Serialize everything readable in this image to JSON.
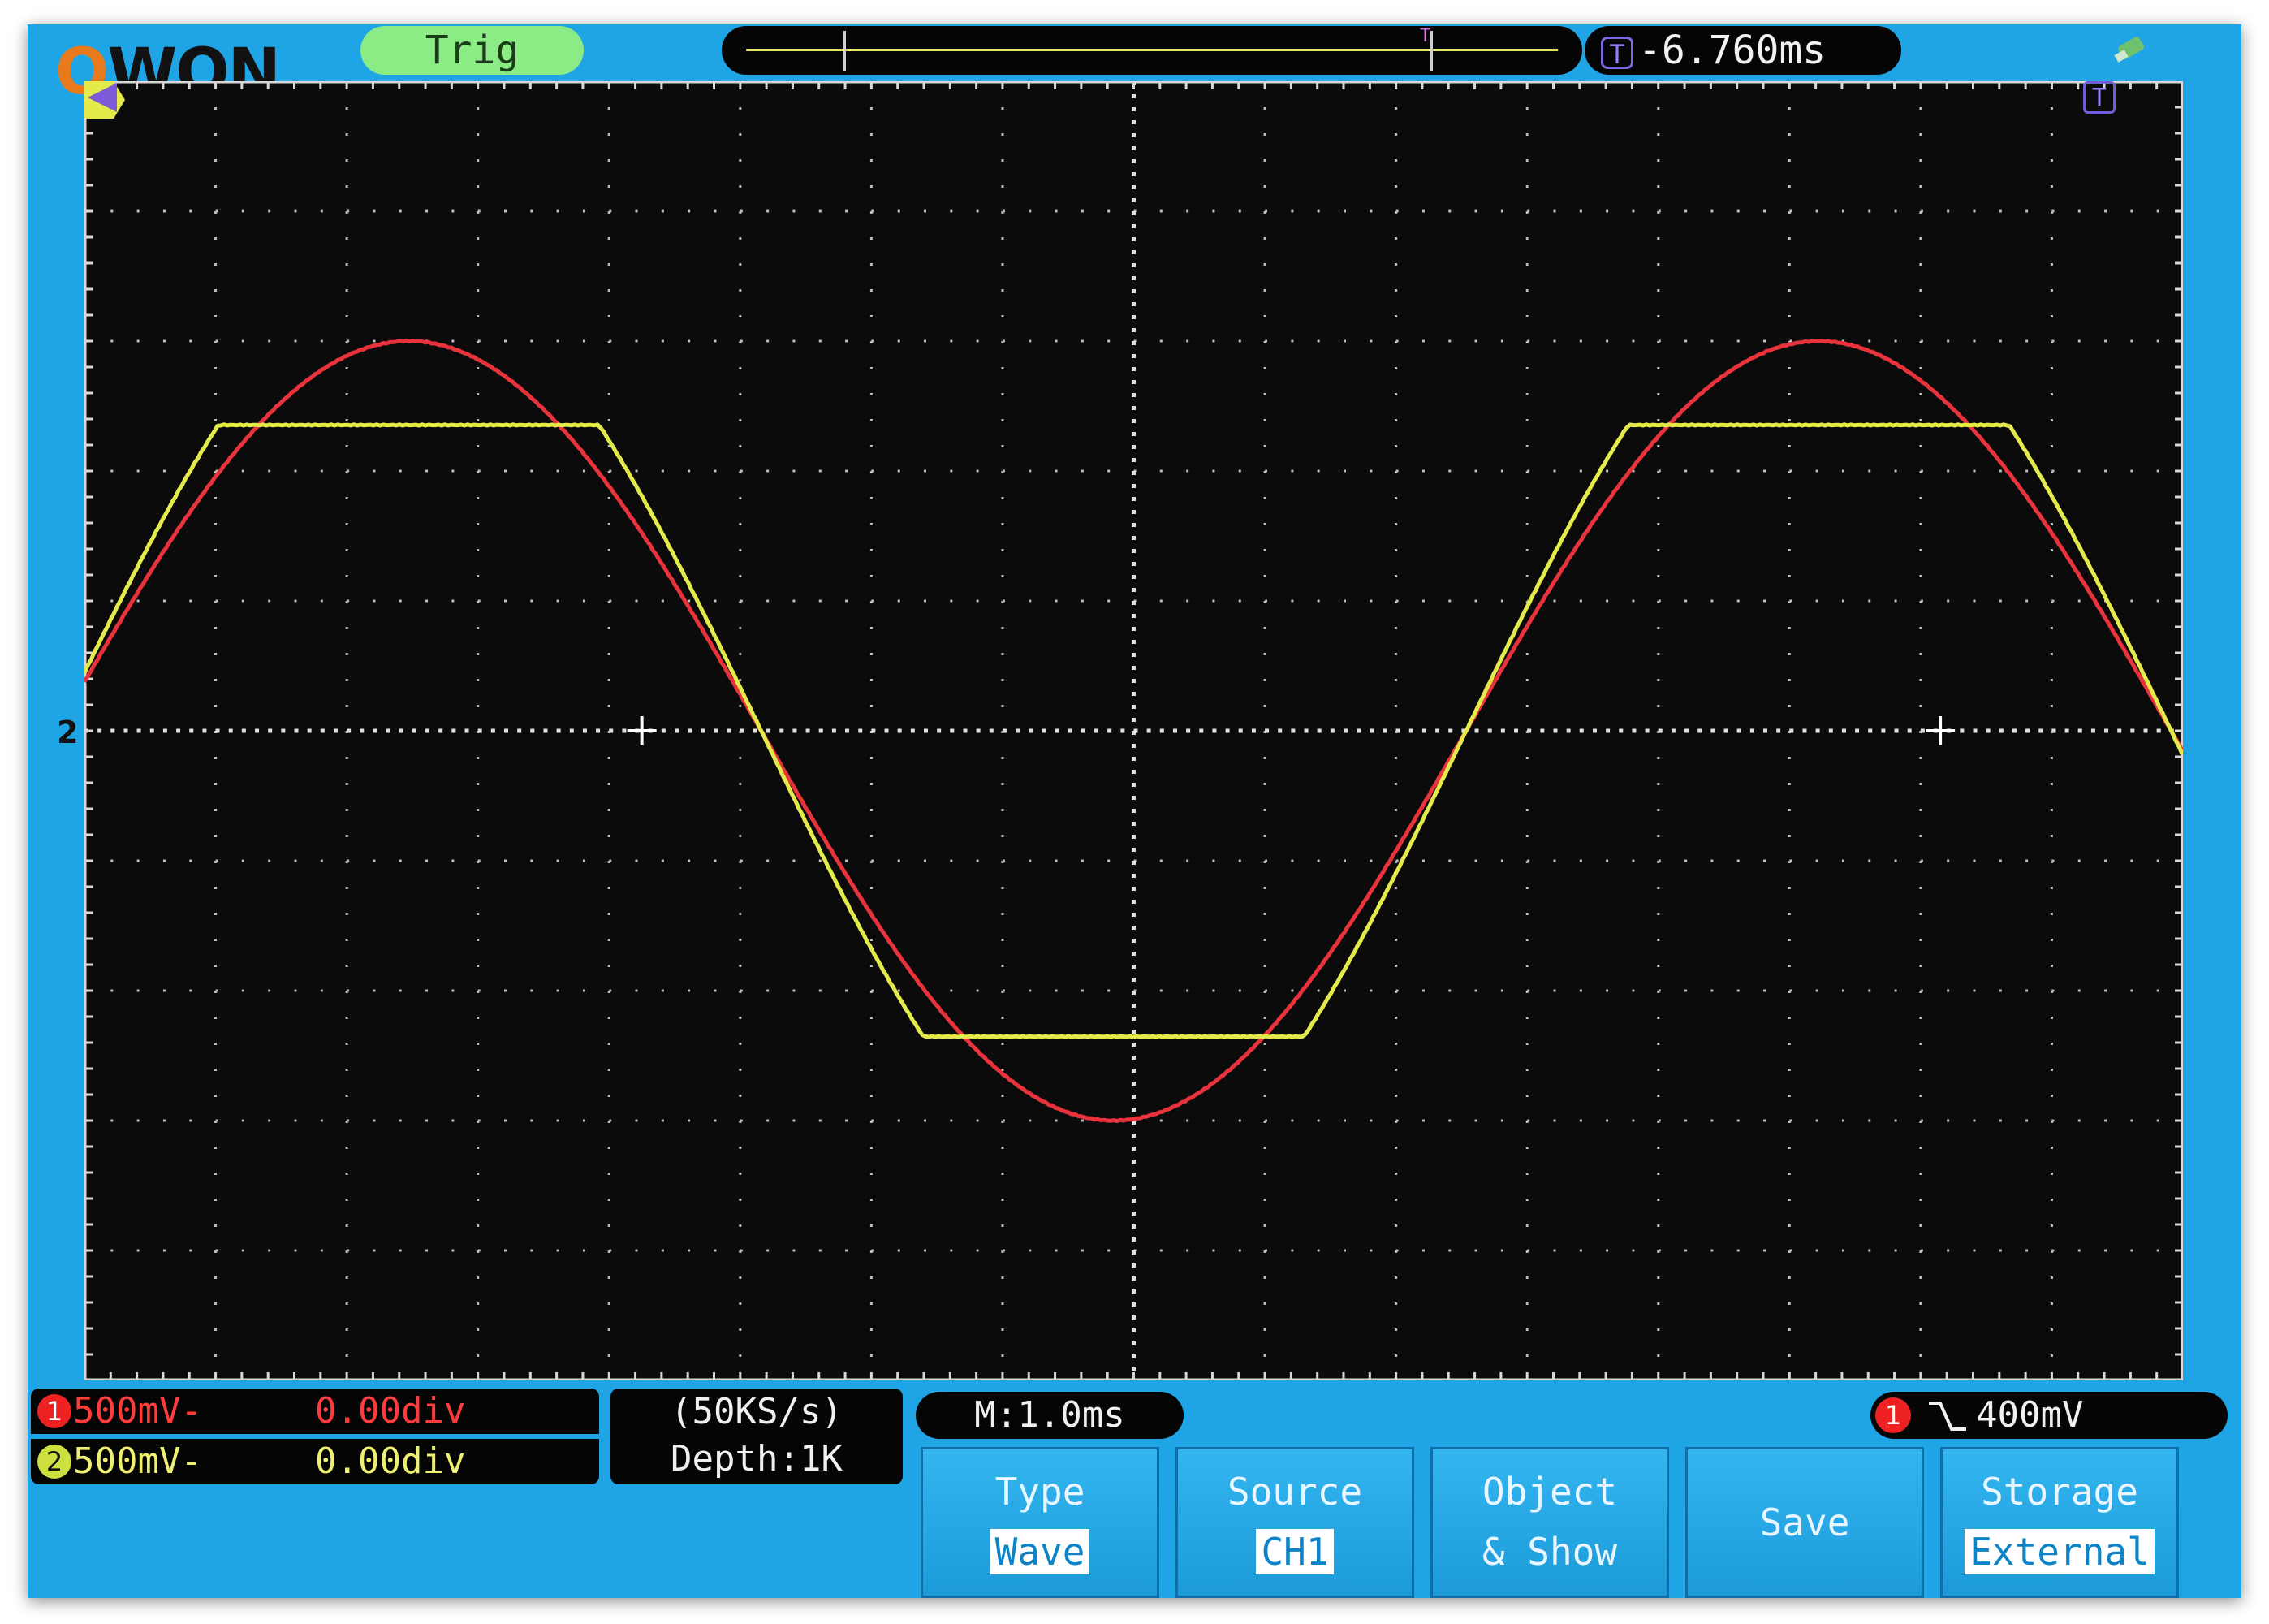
{
  "brand": {
    "logo": "OWON"
  },
  "top_bar": {
    "trigger_status": "Trig",
    "trigger_position": "-6.760ms"
  },
  "screen": {
    "channel2_marker": "2",
    "grid": {
      "h_divisions": 16,
      "v_divisions": 10
    },
    "traces": [
      {
        "name": "CH1",
        "color": "#e8323c",
        "amplitude_div": 3.0,
        "clipped": false
      },
      {
        "name": "CH2",
        "color": "#e4ea4a",
        "amplitude_div": 2.35,
        "clipped": true
      }
    ]
  },
  "channels": {
    "ch1": {
      "number": "1",
      "scale": "500mV-",
      "offset": "0.00div",
      "color": "#ff3b3b"
    },
    "ch2": {
      "number": "2",
      "scale": "500mV-",
      "offset": "0.00div",
      "color": "#e6ef4e"
    }
  },
  "acquisition": {
    "sample_rate": "(50KS/s)",
    "depth": "Depth:1K"
  },
  "timebase": {
    "label": "M:1.0ms"
  },
  "trigger": {
    "source_number": "1",
    "level": "400mV"
  },
  "softkeys": {
    "type": {
      "label": "Type",
      "value": "Wave"
    },
    "source": {
      "label": "Source",
      "value": "CH1"
    },
    "object_show": {
      "line1": "Object",
      "line2": "& Show"
    },
    "save": {
      "label": "Save"
    },
    "storage": {
      "label": "Storage",
      "value": "External"
    }
  },
  "colors": {
    "frame": "#1fa4e6",
    "screen_bg": "#0b0b0b",
    "trigger_pill": "#8bec86"
  }
}
